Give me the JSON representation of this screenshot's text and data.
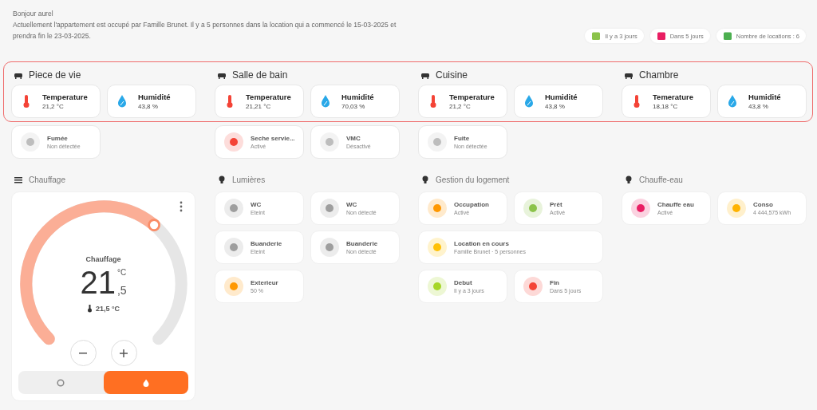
{
  "greeting": {
    "title": "Bonjour aurel",
    "message": "Actuellement l'appartement est occupé par Famille Brunet. Il y a 5 personnes dans la location qui a commencé le 15-03-2025 et prendra fin le 23-03-2025."
  },
  "chips": [
    {
      "label": "Il y a 3 jours",
      "color": "#8bc34a"
    },
    {
      "label": "Dans 5 jours",
      "color": "#e91e63"
    },
    {
      "label": "Nombre de locations : 6",
      "color": "#4caf50"
    }
  ],
  "rooms": [
    {
      "name": "Piece de vie",
      "sensors": [
        {
          "kind": "temperature",
          "name": "Temperature",
          "value": "21,2 °C"
        },
        {
          "kind": "humidity",
          "name": "Humidité",
          "value": "43,8 %"
        }
      ],
      "tiles": [
        {
          "name": "Fumée",
          "state": "Non détectée",
          "color": "#bdbdbd"
        }
      ]
    },
    {
      "name": "Salle de bain",
      "sensors": [
        {
          "kind": "temperature",
          "name": "Temperature",
          "value": "21,21 °C"
        },
        {
          "kind": "humidity",
          "name": "Humidité",
          "value": "70,03 %"
        }
      ],
      "tiles": [
        {
          "name": "Seche servie...",
          "state": "Activé",
          "color": "#f44336"
        },
        {
          "name": "VMC",
          "state": "Désactivé",
          "color": "#bdbdbd"
        }
      ]
    },
    {
      "name": "Cuisine",
      "sensors": [
        {
          "kind": "temperature",
          "name": "Temperature",
          "value": "21,2 °C"
        },
        {
          "kind": "humidity",
          "name": "Humidité",
          "value": "43,8 %"
        }
      ],
      "tiles": [
        {
          "name": "Fuite",
          "state": "Non détectée",
          "color": "#bdbdbd"
        }
      ]
    },
    {
      "name": "Chambre",
      "sensors": [
        {
          "kind": "temperature",
          "name": "Temerature",
          "value": "18,18 °C"
        },
        {
          "kind": "humidity",
          "name": "Humidité",
          "value": "43,8 %"
        }
      ]
    }
  ],
  "thermostat": {
    "section": "Chauffage",
    "title": "Chauffage",
    "value": "21",
    "unit": "°C",
    "decimal": ",5",
    "current": "21,5 °C",
    "modes": [
      {
        "kind": "off",
        "selected": false
      },
      {
        "kind": "heat",
        "selected": true
      }
    ]
  },
  "sections": [
    {
      "title": "Lumières",
      "tiles": [
        {
          "name": "WC",
          "state": "Eteint",
          "color": "#9e9e9e",
          "wide": false
        },
        {
          "name": "WC",
          "state": "Non détecté",
          "color": "#9e9e9e",
          "wide": false
        },
        {
          "name": "Buanderie",
          "state": "Eteint",
          "color": "#9e9e9e",
          "wide": false
        },
        {
          "name": "Buanderie",
          "state": "Non détecté",
          "color": "#9e9e9e",
          "wide": false
        },
        {
          "name": "Exterieur",
          "state": "50 %",
          "color": "#ff9800",
          "wide": false
        }
      ]
    },
    {
      "title": "Gestion du logement",
      "tiles": [
        {
          "name": "Occupation",
          "state": "Activé",
          "color": "#ff9800",
          "wide": false
        },
        {
          "name": "Prêt",
          "state": "Activé",
          "color": "#8bc34a",
          "wide": false
        },
        {
          "name": "Location en cours",
          "state": "Famille Brunet · 5 personnes",
          "color": "#ffc107",
          "wide": true
        },
        {
          "name": "Debut",
          "state": "Il y a 3 jours",
          "color": "#a5d626",
          "wide": false
        },
        {
          "name": "Fin",
          "state": "Dans 5 jours",
          "color": "#f44336",
          "wide": false
        }
      ]
    },
    {
      "title": "Chauffe-eau",
      "tiles": [
        {
          "name": "Chauffe eau",
          "state": "Activé",
          "color": "#e91e63",
          "wide": false
        },
        {
          "name": "Conso",
          "state": "4 444,575 kWh",
          "color": "#ffb300",
          "wide": false
        }
      ]
    }
  ]
}
